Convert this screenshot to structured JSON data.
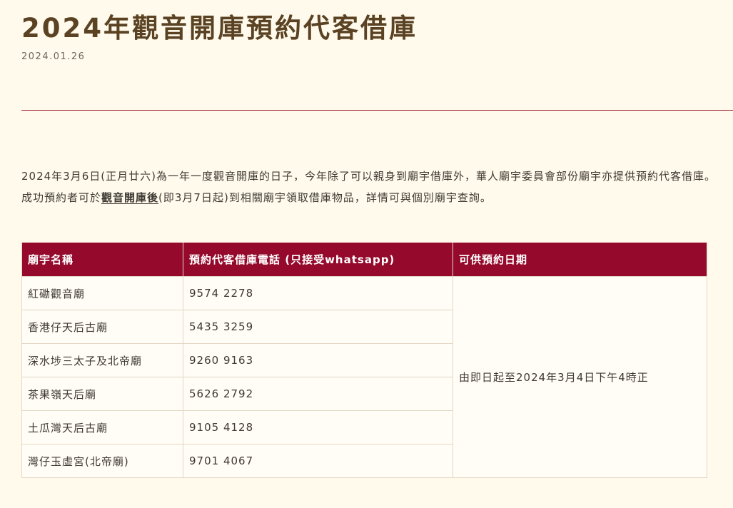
{
  "article": {
    "title": "2024年觀音開庫預約代客借庫",
    "date": "2024.01.26",
    "intro_part1": "2024年3月6日(正月廿六)為一年一度觀音開庫的日子，今年除了可以親身到廟宇借庫外，華人廟宇委員會部份廟宇亦提供預約代客借庫。成功預約者可於",
    "intro_emphasis": "觀音開庫後",
    "intro_part2": "(即3月7日起)到相關廟宇領取借庫物品，詳情可與個別廟宇查詢。"
  },
  "table": {
    "headers": {
      "name": "廟宇名稱",
      "phone": "預約代客借庫電話 (只接受whatsapp)",
      "dates": "可供預約日期"
    },
    "rows": [
      {
        "name": "紅磡觀音廟",
        "phone": "9574 2278"
      },
      {
        "name": "香港仔天后古廟",
        "phone": "5435 3259"
      },
      {
        "name": "深水埗三太子及北帝廟",
        "phone": "9260 9163"
      },
      {
        "name": "茶果嶺天后廟",
        "phone": "5626 2792"
      },
      {
        "name": "土瓜灣天后古廟",
        "phone": "9105 4128"
      },
      {
        "name": "灣仔玉虛宮(北帝廟)",
        "phone": "9701 4067"
      }
    ],
    "booking_period": "由即日起至2024年3月4日下午4時正"
  }
}
